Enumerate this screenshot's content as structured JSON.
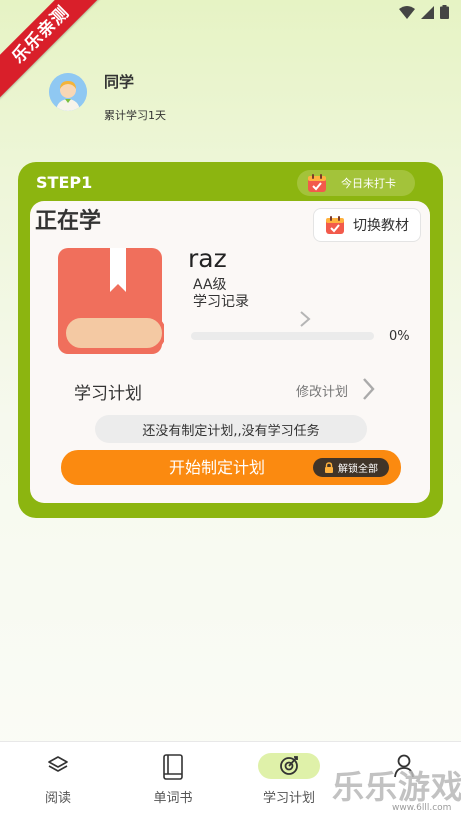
{
  "watermark": {
    "corner": "乐乐亲测",
    "brand": "乐乐游戏",
    "url": "www.6lll.com"
  },
  "user": {
    "name": "同学",
    "days": "累计学习1天"
  },
  "step": {
    "label": "STEP1",
    "checkin": "今日未打卡"
  },
  "learning": {
    "title": "正在学",
    "switch_label": "切换教材",
    "book_name": "raz",
    "level": "AA级",
    "record_label": "学习记录",
    "progress_text": "0%",
    "progress_value": 0
  },
  "plan": {
    "title": "学习计划",
    "edit_label": "修改计划",
    "empty_text": "还没有制定计划,,没有学习任务",
    "start_label": "开始制定计划",
    "unlock_label": "解锁全部"
  },
  "nav": {
    "items": [
      {
        "label": "阅读",
        "icon": "layers-icon"
      },
      {
        "label": "单词书",
        "icon": "book-icon"
      },
      {
        "label": "学习计划",
        "icon": "target-icon",
        "active": true
      },
      {
        "label": "我的",
        "icon": "person-icon"
      }
    ]
  },
  "colors": {
    "accent": "#8cb510",
    "button": "#fb8a10",
    "book": "#f06f5c"
  }
}
